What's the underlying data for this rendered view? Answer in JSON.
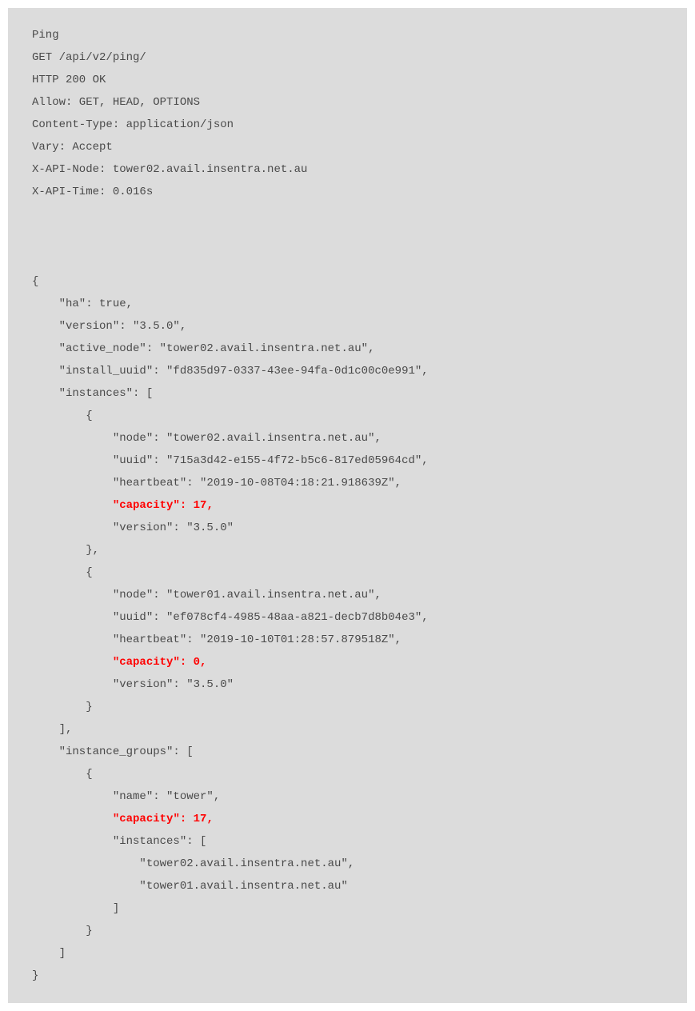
{
  "headers": {
    "title": "Ping",
    "request": "GET /api/v2/ping/",
    "status": "HTTP 200 OK",
    "allow": "Allow: GET, HEAD, OPTIONS",
    "content_type": "Content-Type: application/json",
    "vary": "Vary: Accept",
    "api_node": "X-API-Node: tower02.avail.insentra.net.au",
    "api_time": "X-API-Time: 0.016s"
  },
  "json": {
    "open": "{",
    "ha": "    \"ha\": true,",
    "version": "    \"version\": \"3.5.0\",",
    "active_node": "    \"active_node\": \"tower02.avail.insentra.net.au\",",
    "install_uuid": "    \"install_uuid\": \"fd835d97-0337-43ee-94fa-0d1c00c0e991\",",
    "instances_open": "    \"instances\": [",
    "inst0_open": "        {",
    "inst0_node": "            \"node\": \"tower02.avail.insentra.net.au\",",
    "inst0_uuid": "            \"uuid\": \"715a3d42-e155-4f72-b5c6-817ed05964cd\",",
    "inst0_heartbeat": "            \"heartbeat\": \"2019-10-08T04:18:21.918639Z\",",
    "inst0_capacity_indent": "            ",
    "inst0_capacity": "\"capacity\": 17,",
    "inst0_version": "            \"version\": \"3.5.0\"",
    "inst0_close": "        },",
    "inst1_open": "        {",
    "inst1_node": "            \"node\": \"tower01.avail.insentra.net.au\",",
    "inst1_uuid": "            \"uuid\": \"ef078cf4-4985-48aa-a821-decb7d8b04e3\",",
    "inst1_heartbeat": "            \"heartbeat\": \"2019-10-10T01:28:57.879518Z\",",
    "inst1_capacity_indent": "            ",
    "inst1_capacity": "\"capacity\": 0,",
    "inst1_version": "            \"version\": \"3.5.0\"",
    "inst1_close": "        }",
    "instances_close": "    ],",
    "groups_open": "    \"instance_groups\": [",
    "grp0_open": "        {",
    "grp0_name": "            \"name\": \"tower\",",
    "grp0_capacity_indent": "            ",
    "grp0_capacity": "\"capacity\": 17,",
    "grp0_instances_open": "            \"instances\": [",
    "grp0_inst0": "                \"tower02.avail.insentra.net.au\",",
    "grp0_inst1": "                \"tower01.avail.insentra.net.au\"",
    "grp0_instances_close": "            ]",
    "grp0_close": "        }",
    "groups_close": "    ]",
    "close": "}"
  }
}
